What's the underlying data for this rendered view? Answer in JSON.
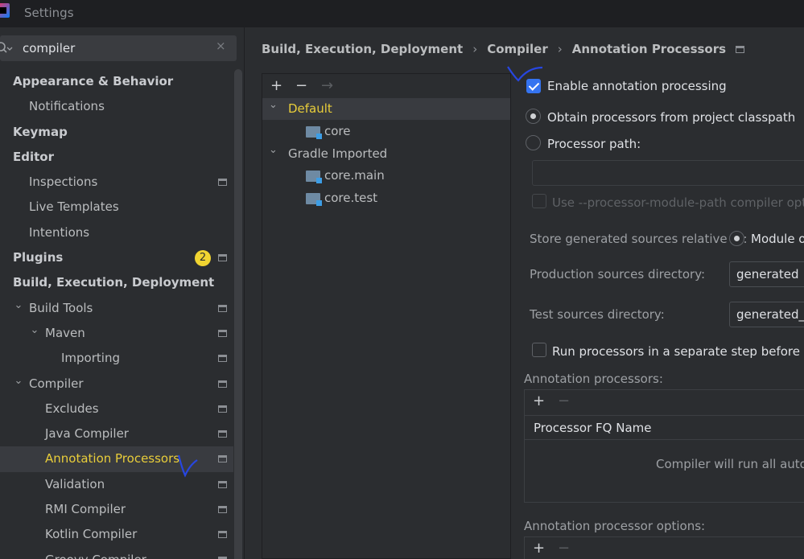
{
  "window": {
    "title": "Settings"
  },
  "search": {
    "value": "compiler",
    "clear": "×"
  },
  "sidebar": {
    "items": [
      {
        "label": "Appearance & Behavior",
        "level": 0,
        "chevron": "down",
        "bold": true
      },
      {
        "label": "Notifications",
        "level": 1
      },
      {
        "label": "Keymap",
        "level": 0,
        "bold": true
      },
      {
        "label": "Editor",
        "level": 0,
        "chevron": "down",
        "bold": true
      },
      {
        "label": "Inspections",
        "level": 1,
        "config": true
      },
      {
        "label": "Live Templates",
        "level": 1
      },
      {
        "label": "Intentions",
        "level": 1
      },
      {
        "label": "Plugins",
        "level": 0,
        "bold": true,
        "badge": "2",
        "config": true
      },
      {
        "label": "Build, Execution, Deployment",
        "level": 0,
        "chevron": "down",
        "bold": true
      },
      {
        "label": "Build Tools",
        "level": 1,
        "chevron": "down",
        "config": true
      },
      {
        "label": "Maven",
        "level": 2,
        "chevron": "down",
        "config": true
      },
      {
        "label": "Importing",
        "level": 3,
        "config": true
      },
      {
        "label": "Compiler",
        "level": 1,
        "chevron": "down",
        "config": true
      },
      {
        "label": "Excludes",
        "level": 2,
        "config": true
      },
      {
        "label": "Java Compiler",
        "level": 2,
        "config": true
      },
      {
        "label": "Annotation Processors",
        "level": 2,
        "config": true,
        "selected": true
      },
      {
        "label": "Validation",
        "level": 2,
        "config": true
      },
      {
        "label": "RMI Compiler",
        "level": 2,
        "config": true
      },
      {
        "label": "Kotlin Compiler",
        "level": 2,
        "config": true
      },
      {
        "label": "Groovy Compiler",
        "level": 2,
        "config": true
      }
    ]
  },
  "breadcrumb": {
    "items": [
      "Build, Execution, Deployment",
      "Compiler",
      "Annotation Processors"
    ],
    "sep": "›"
  },
  "profiles": {
    "toolbar": {
      "add": "+",
      "remove": "−",
      "move": "→"
    },
    "rows": [
      {
        "label": "Default",
        "chevron": true,
        "selected": true,
        "highlight": true
      },
      {
        "label": "core",
        "folder": true
      },
      {
        "label": "Gradle Imported",
        "chevron": true
      },
      {
        "label": "core.main",
        "folder": true
      },
      {
        "label": "core.test",
        "folder": true
      }
    ]
  },
  "options": {
    "enable_processing": "Enable annotation processing",
    "enable_checked": true,
    "obtain_classpath": "Obtain processors from project classpath",
    "processor_path": "Processor path:",
    "processor_path_value": "",
    "use_module_path": "Use --processor-module-path compiler option",
    "store_generated_label": "Store generated sources relative to:",
    "module_option": "Module o",
    "production_dir_label": "Production sources directory:",
    "production_dir_value": "generated",
    "test_dir_label": "Test sources directory:",
    "test_dir_value": "generated_te",
    "run_separate": "Run processors in a separate step before comp",
    "annotation_processors_label": "Annotation processors:",
    "fq_name_header": "Processor FQ Name",
    "empty_text": "Compiler will run all autom",
    "processor_options_label": "Annotation processor options:"
  },
  "colors": {
    "background": "#2b2d30",
    "titlebar": "#1e1f22",
    "selection": "#393b40",
    "highlight": "#e8cd3a",
    "checkbox_accent": "#3574f0",
    "badge": "#f0d431",
    "pen_marks": "#2746e0"
  }
}
